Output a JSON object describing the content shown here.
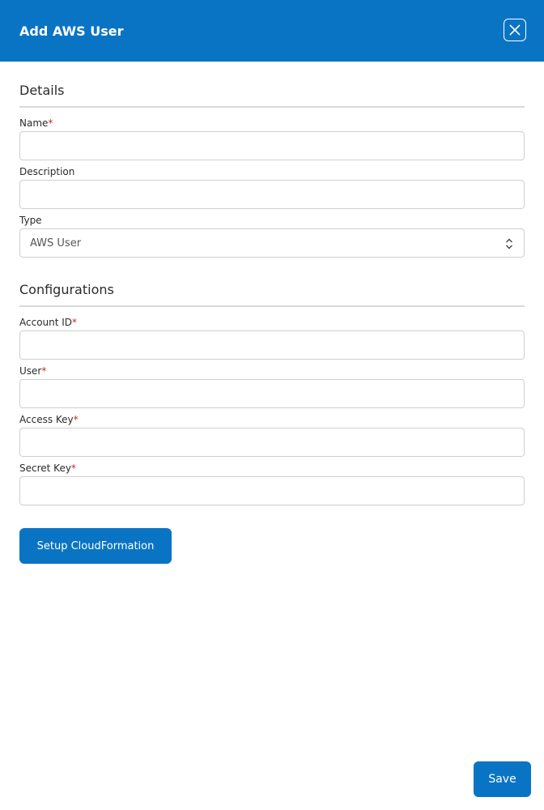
{
  "header": {
    "title": "Add AWS User",
    "close_icon": "close-icon",
    "background": "#0a74c4"
  },
  "details": {
    "title": "Details",
    "name": {
      "label": "Name",
      "required": "*",
      "value": ""
    },
    "description": {
      "label": "Description",
      "value": ""
    },
    "type": {
      "label": "Type",
      "selected": "AWS User",
      "icon": "select-arrows-icon"
    }
  },
  "configurations": {
    "title": "Configurations",
    "account_id": {
      "label": "Account ID",
      "required": "*",
      "value": ""
    },
    "user": {
      "label": "User",
      "required": "*",
      "value": ""
    },
    "access_key": {
      "label": "Access Key",
      "required": "*",
      "value": ""
    },
    "secret_key": {
      "label": "Secret Key",
      "required": "*",
      "value": ""
    }
  },
  "actions": {
    "setup_cloudformation": "Setup CloudFormation",
    "save": "Save"
  },
  "colors": {
    "accent": "#0a74c4",
    "required": "#c62828"
  }
}
